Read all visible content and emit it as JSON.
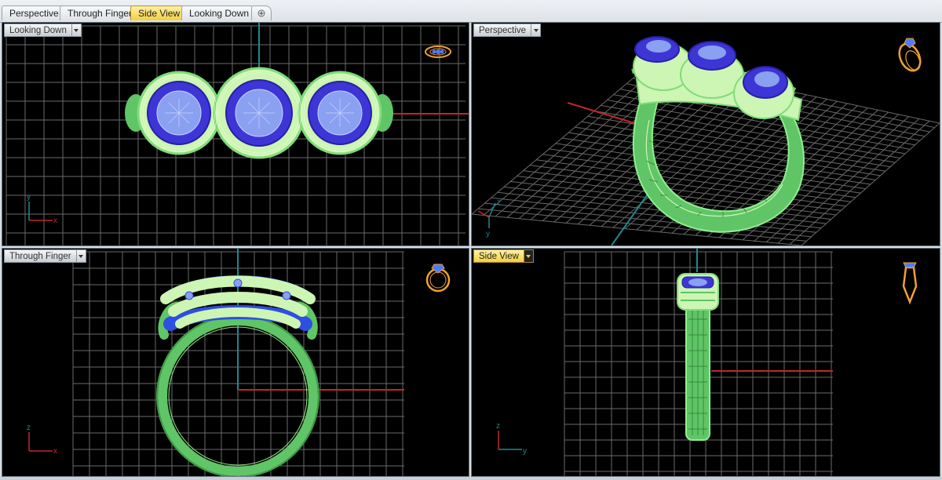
{
  "tabs": [
    {
      "label": "Perspective",
      "active": false
    },
    {
      "label": "Through Finger",
      "active": false
    },
    {
      "label": "Side View",
      "active": true
    },
    {
      "label": "Looking Down",
      "active": false
    }
  ],
  "viewports": {
    "top_left": {
      "label": "Looking Down",
      "active": false
    },
    "top_right": {
      "label": "Perspective",
      "active": false
    },
    "bottom_left": {
      "label": "Through Finger",
      "active": false
    },
    "bottom_right": {
      "label": "Side View",
      "active": true
    }
  },
  "axes": {
    "x": "x",
    "y": "y",
    "z": "z"
  },
  "colors": {
    "background": "#000000",
    "grid": "#6b6b6b",
    "x_axis": "#c0282a",
    "y_axis": "#1f8a8f",
    "ring_band": "#5fc566",
    "ring_highlight": "#cdf5b3",
    "gemstone": "#3d35d6",
    "gem_center": "#8aa0f0",
    "nav_widget": "#f0a030",
    "active_tab": "#f2cf3e"
  },
  "icons": [
    "plus-icon",
    "chevron-down-icon",
    "ring-navigation-icon"
  ]
}
